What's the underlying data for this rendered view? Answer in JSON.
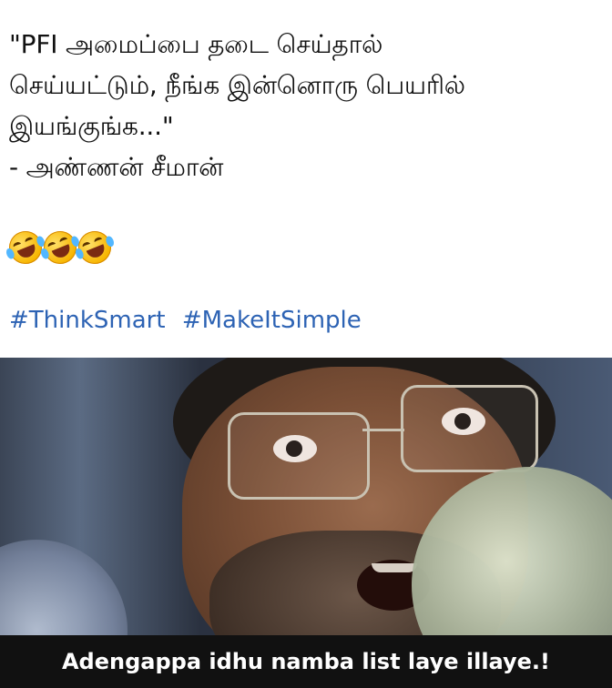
{
  "post": {
    "lines": [
      "\"PFI அமைப்பை தடை செய்தால்",
      "செய்யட்டும், நீங்க இன்னொரு பெயரில்",
      "இயங்குங்க...\"",
      "- அண்ணன் சீமான்"
    ],
    "emoji_count": 3,
    "emoji_name": "rolling-on-the-floor-laughing-emoji",
    "hashtags": [
      "#ThinkSmart",
      "#MakeItSimple"
    ],
    "hashtag_color": "#2d63b4"
  },
  "meme": {
    "caption": "Adengappa idhu namba list laye illaye.!"
  }
}
